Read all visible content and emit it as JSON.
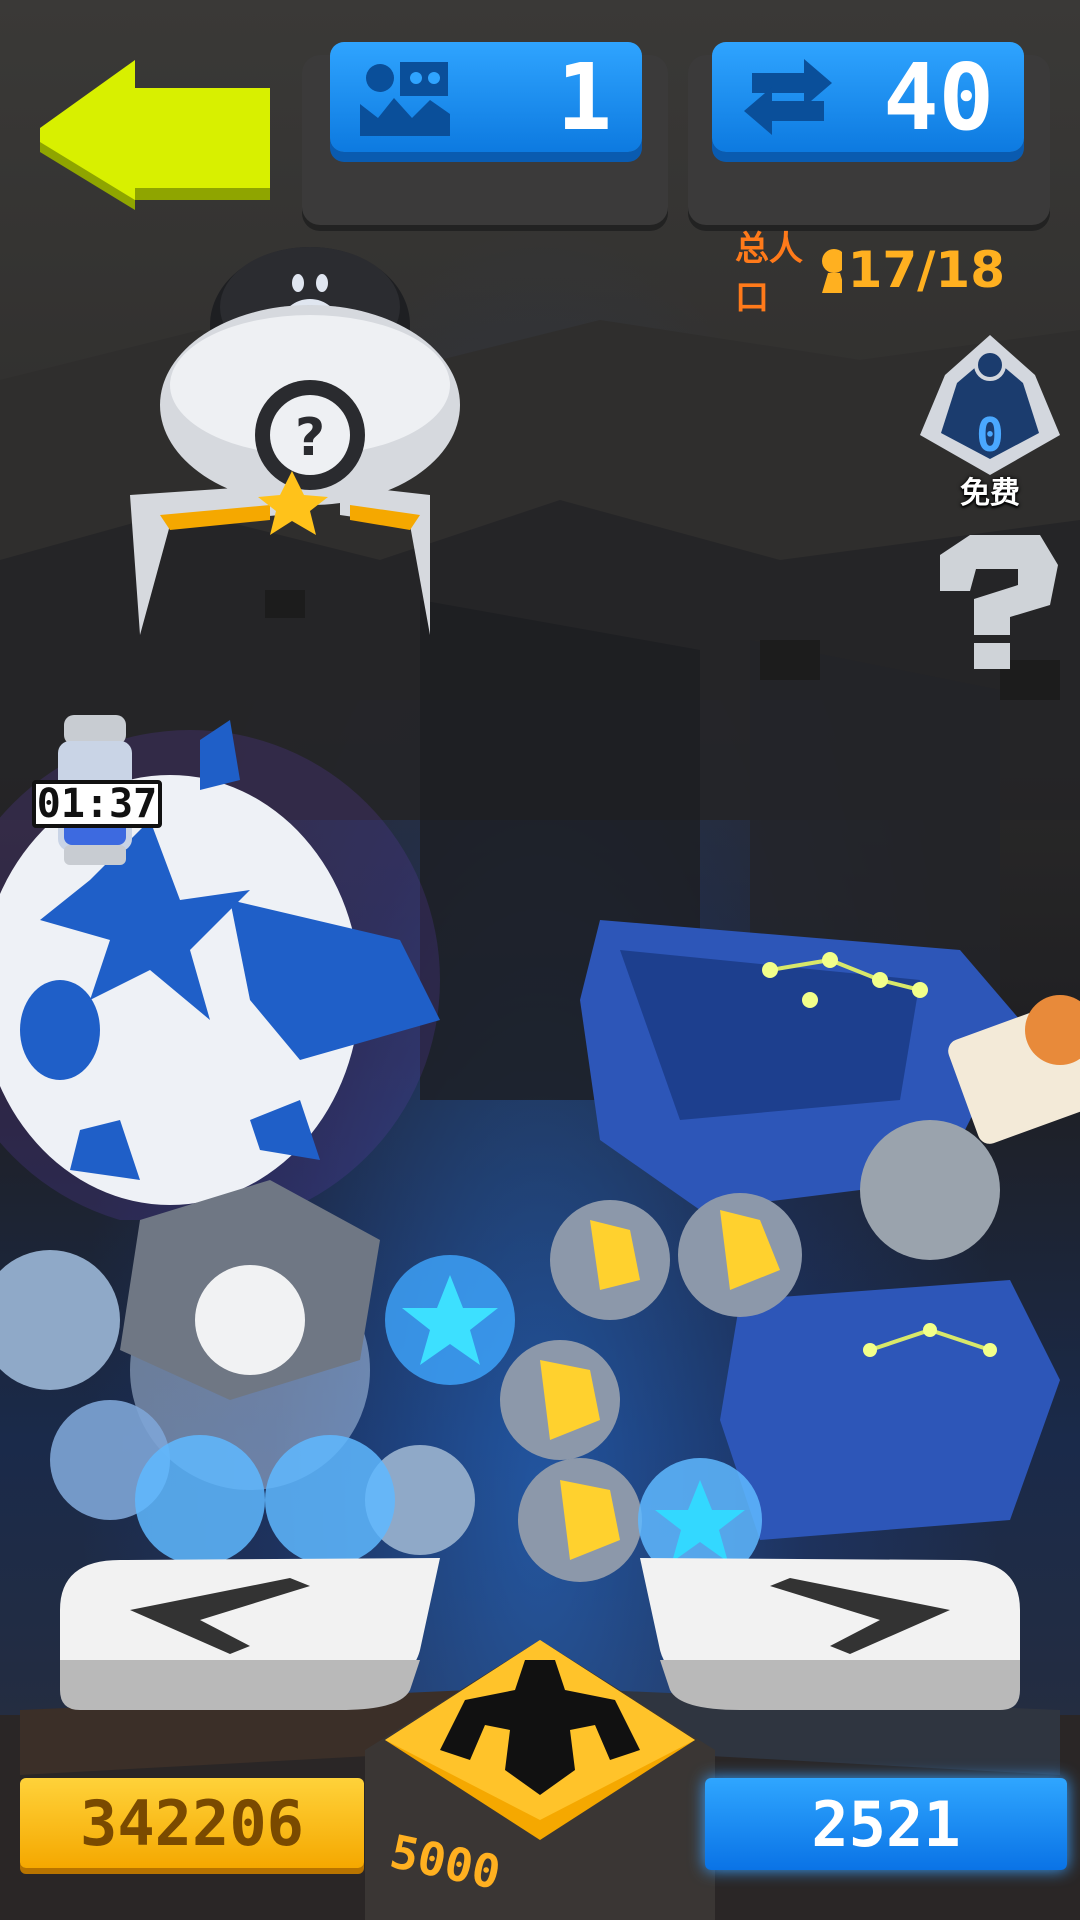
{
  "hud": {
    "level_value": "1",
    "level_icon": "monster-level-icon",
    "moves_value": "40",
    "moves_icon": "swap-arrows-icon"
  },
  "population": {
    "label": "总人口",
    "value": "17/18",
    "icon": "person-icon"
  },
  "free_draw": {
    "count": "0",
    "label": "免费"
  },
  "help": {
    "icon": "question-mark-icon"
  },
  "egg": {
    "timer": "01:37"
  },
  "bottom": {
    "coins": "342206",
    "gems": "2521",
    "claw_cost": "5000"
  },
  "colors": {
    "accent_blue": "#1389ef",
    "accent_yellow": "#ffc21a",
    "back_arrow": "#d8f000",
    "pop_label": "#ff7a1a"
  }
}
